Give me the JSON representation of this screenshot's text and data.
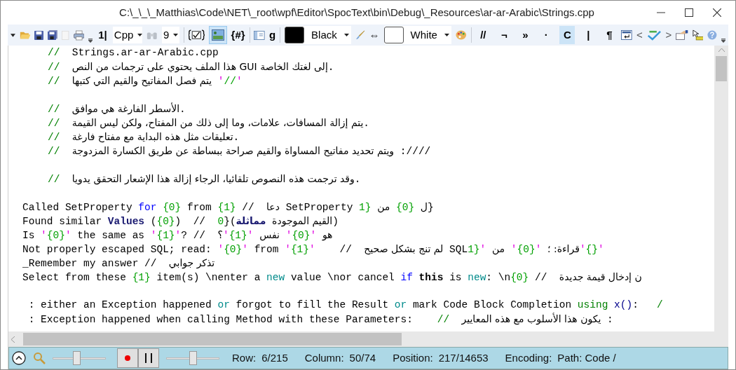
{
  "window": {
    "title": "C:\\_\\_\\_Matthias\\Code\\NET\\_root\\wpf\\Editor\\SpocText\\bin\\Debug\\_Resources\\ar-ar-Arabic\\Strings.cpp"
  },
  "toolbar": {
    "line_numbers": "1|",
    "language": "Cpp",
    "font_size": "9",
    "image_toggle": {
      "selected": true
    },
    "region_button": "{#}",
    "grid_button": "g",
    "foreground": {
      "name": "Black",
      "color": "#000000"
    },
    "swap": "⇔",
    "background": {
      "name": "White",
      "color": "#ffffff"
    },
    "toggles": [
      {
        "label": "//",
        "selected": false
      },
      {
        "label": "¬",
        "selected": false
      },
      {
        "label": "»",
        "selected": false
      },
      {
        "label": "·",
        "selected": false
      },
      {
        "label": "C",
        "selected": true
      },
      {
        "label": "|",
        "selected": false
      },
      {
        "label": "¶",
        "selected": false
      }
    ],
    "prev": "<",
    "next": ">"
  },
  "editor": {
    "lines": [
      {
        "kind": "comment",
        "tokens": [
          {
            "kind": "comment",
            "text": "//"
          },
          {
            "kind": "plain",
            "text": "  Strings.ar-ar-Arabic.cpp"
          }
        ]
      },
      {
        "kind": "comment",
        "tokens": [
          {
            "kind": "comment",
            "text": "//"
          },
          {
            "kind": "plain",
            "text": "  إلى لغتك الخاصة GUI هذا الملف يحتوي على ترجمات من النص."
          }
        ]
      },
      {
        "kind": "comment",
        "tokens": [
          {
            "kind": "comment",
            "text": "//"
          },
          {
            "kind": "plain",
            "text": "  يتم فصل المفاتيح والقيم التي كتبها "
          },
          {
            "kind": "string",
            "text": "'//'"
          }
        ]
      },
      {
        "kind": "blank"
      },
      {
        "kind": "comment",
        "tokens": [
          {
            "kind": "comment",
            "text": "//"
          },
          {
            "kind": "plain",
            "text": "  الأسطر الفارغة هي موافق."
          }
        ]
      },
      {
        "kind": "comment",
        "tokens": [
          {
            "kind": "comment",
            "text": "//"
          },
          {
            "kind": "plain",
            "text": "  يتم إزالة المسافات، علامات، وما إلى ذلك من المفتاح، ولكن ليس القيمة."
          }
        ]
      },
      {
        "kind": "comment",
        "tokens": [
          {
            "kind": "comment",
            "text": "//"
          },
          {
            "kind": "plain",
            "text": "  تعليقات مثل هذه البداية مع مفتاح فارغة."
          }
        ]
      },
      {
        "kind": "comment",
        "tokens": [
          {
            "kind": "comment",
            "text": "//"
          },
          {
            "kind": "plain",
            "text": "  ويتم تحديد مفاتيح المساواة والقيم صراحة ببساطة عن طريق الكسارة المزدوجة :////"
          }
        ]
      },
      {
        "kind": "blank"
      },
      {
        "kind": "comment",
        "tokens": [
          {
            "kind": "comment",
            "text": "//"
          },
          {
            "kind": "plain",
            "text": "  وقد ترجمت هذه النصوص تلقائيا، الرجاء إزالة هذا الإشعار التحقق يدويا."
          }
        ]
      },
      {
        "kind": "blank"
      },
      {
        "kind": "code",
        "tokens": [
          {
            "kind": "plain",
            "text": "Called SetProperty "
          },
          {
            "kind": "keyword",
            "text": "for"
          },
          {
            "kind": "number",
            "text": " {0}"
          },
          {
            "kind": "plain",
            "text": " from "
          },
          {
            "kind": "number",
            "text": "{1}"
          },
          {
            "kind": "plain",
            "text": " //  دعا SetProperty "
          },
          {
            "kind": "number",
            "text": "1}"
          },
          {
            "kind": "plain",
            "text": " من "
          },
          {
            "kind": "number",
            "text": "{0}"
          },
          {
            "kind": "plain",
            "text": " ل}"
          }
        ]
      },
      {
        "kind": "code",
        "tokens": [
          {
            "kind": "plain",
            "text": "Found similar "
          },
          {
            "kind": "type",
            "text": "Values"
          },
          {
            "kind": "plain",
            "text": " ("
          },
          {
            "kind": "number",
            "text": "{0}"
          },
          {
            "kind": "plain",
            "text": ")  //  "
          },
          {
            "kind": "number",
            "text": "0"
          },
          {
            "kind": "plain",
            "text": "}("
          },
          {
            "kind": "type",
            "text": "مماثلة"
          },
          {
            "kind": "plain",
            "text": " القيم الموجودة"
          },
          {
            "kind": "plain",
            "text": ")"
          }
        ]
      },
      {
        "kind": "code",
        "tokens": [
          {
            "kind": "plain",
            "text": "Is "
          },
          {
            "kind": "string",
            "text": "'{0}'"
          },
          {
            "kind": "plain",
            "text": " the same as "
          },
          {
            "kind": "string",
            "text": "'{1}'"
          },
          {
            "kind": "plain",
            "text": "? //  ؟"
          },
          {
            "kind": "string",
            "text": "'{1}'"
          },
          {
            "kind": "plain",
            "text": " نفس "
          },
          {
            "kind": "string",
            "text": "'{0}'"
          },
          {
            "kind": "plain",
            "text": " هو"
          }
        ]
      },
      {
        "kind": "code",
        "tokens": [
          {
            "kind": "plain",
            "text": "Not properly escaped SQL; read: "
          },
          {
            "kind": "string",
            "text": "'{0}'"
          },
          {
            "kind": "plain",
            "text": " from "
          },
          {
            "kind": "string",
            "text": "'{1}'"
          },
          {
            "kind": "plain",
            "text": "    //  لم تنج بشكل صحيح SQL"
          },
          {
            "kind": "number",
            "text": "1}"
          },
          {
            "kind": "string",
            "text": "'"
          },
          {
            "kind": "plain",
            "text": " من "
          },
          {
            "kind": "string",
            "text": "'{0}'"
          },
          {
            "kind": "plain",
            "text": " قراءة: ؛"
          },
          {
            "kind": "string",
            "text": "'{}'"
          }
        ]
      },
      {
        "kind": "code",
        "tokens": [
          {
            "kind": "plain",
            "text": "_Remember my answer //  تذكر جوابي"
          }
        ]
      },
      {
        "kind": "code",
        "tokens": [
          {
            "kind": "plain",
            "text": "Select from these "
          },
          {
            "kind": "number",
            "text": "{1}"
          },
          {
            "kind": "plain",
            "text": " item(s) \\nenter a "
          },
          {
            "kind": "teal",
            "text": "new"
          },
          {
            "kind": "plain",
            "text": " value \\nor cancel "
          },
          {
            "kind": "keyword",
            "text": "if"
          },
          {
            "kind": "bold",
            "text": " this"
          },
          {
            "kind": "plain",
            "text": " is "
          },
          {
            "kind": "teal",
            "text": "new"
          },
          {
            "kind": "plain",
            "text": ": \\n"
          },
          {
            "kind": "number",
            "text": "{0}"
          },
          {
            "kind": "plain",
            "text": " //  ن إدخال قيمة جديدة"
          }
        ]
      },
      {
        "kind": "blank"
      },
      {
        "kind": "code",
        "tokens": [
          {
            "kind": "plain",
            "text": " : either an Exception happened "
          },
          {
            "kind": "teal",
            "text": "or"
          },
          {
            "kind": "plain",
            "text": " forgot to fill the Result "
          },
          {
            "kind": "teal",
            "text": "or"
          },
          {
            "kind": "plain",
            "text": " mark Code Block Completion "
          },
          {
            "kind": "using",
            "text": "using"
          },
          {
            "kind": "method",
            "text": " x()"
          },
          {
            "kind": "plain",
            "text": ":   "
          },
          {
            "kind": "comment",
            "text": "/"
          }
        ]
      },
      {
        "kind": "code",
        "tokens": [
          {
            "kind": "plain",
            "text": " : Exception happened when calling Method with these Parameters:    "
          },
          {
            "kind": "comment",
            "text": "//"
          },
          {
            "kind": "plain",
            "text": "  يكون هذا الأسلوب مع هذه المعايير :"
          }
        ]
      }
    ]
  },
  "status_bar": {
    "zoom_slider": {
      "level": 0.45
    },
    "speed_slider": {
      "level": 0.5
    },
    "fields": [
      {
        "label": "Row:",
        "value": "6/215"
      },
      {
        "label": "Column:",
        "value": "50/74"
      },
      {
        "label": "Position:",
        "value": "217/14653"
      },
      {
        "label": "Encoding:",
        "value": "Path: Code /"
      }
    ]
  }
}
